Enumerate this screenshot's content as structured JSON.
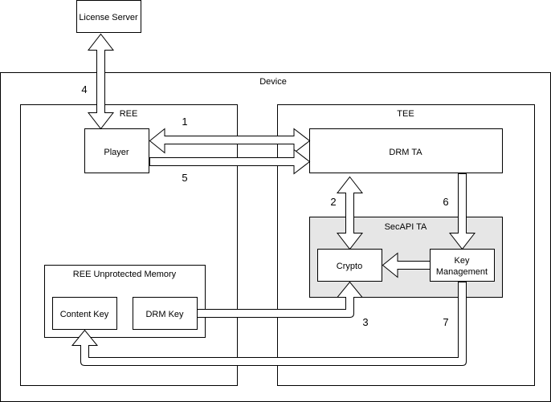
{
  "diagram": {
    "type": "architecture",
    "containers": {
      "device": "Device",
      "ree": "REE",
      "tee": "TEE",
      "secapi": "SecAPI TA",
      "ree_memory": "REE Unprotected Memory"
    },
    "nodes": {
      "license_server": "License Server",
      "player": "Player",
      "drm_ta": "DRM TA",
      "crypto": "Crypto",
      "key_management_line1": "Key",
      "key_management_line2": "Management",
      "content_key": "Content Key",
      "drm_key": "DRM Key"
    },
    "steps": {
      "s1": "1",
      "s2": "2",
      "s3": "3",
      "s4": "4",
      "s5": "5",
      "s6": "6",
      "s7": "7"
    },
    "edges": [
      {
        "step": "1",
        "from": "DRM TA",
        "to": "Player",
        "direction": "bidirectional"
      },
      {
        "step": "2",
        "from": "DRM TA",
        "to": "Crypto",
        "direction": "bidirectional"
      },
      {
        "step": "3",
        "from": "DRM Key",
        "to": "Crypto",
        "direction": "forward"
      },
      {
        "step": "4",
        "from": "License Server",
        "to": "Player",
        "direction": "bidirectional"
      },
      {
        "step": "5",
        "from": "Player",
        "to": "DRM TA",
        "direction": "forward"
      },
      {
        "step": "6",
        "from": "DRM TA",
        "to": "Key Management",
        "direction": "forward"
      },
      {
        "step": "7",
        "from": "Key Management",
        "to": "Content Key",
        "direction": "forward"
      },
      {
        "step": "",
        "from": "Key Management",
        "to": "Crypto",
        "direction": "forward"
      }
    ]
  }
}
